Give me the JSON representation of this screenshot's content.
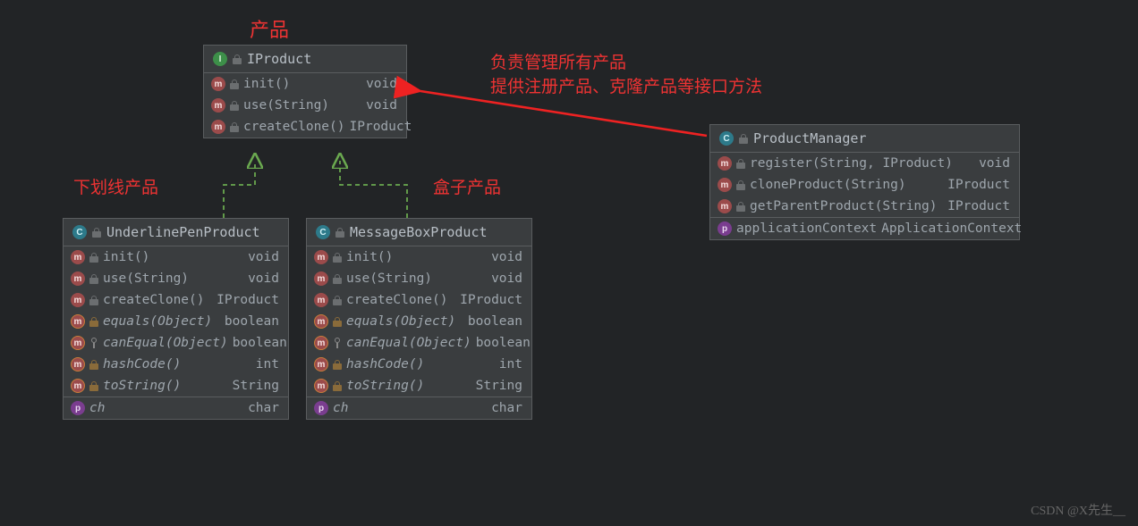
{
  "annotations": {
    "product": "产品",
    "underline": "下划线产品",
    "box": "盒子产品",
    "manager1": "负责管理所有产品",
    "manager2": "提供注册产品、克隆产品等接口方法"
  },
  "iproduct": {
    "title": "IProduct",
    "rows": [
      {
        "ic": "m",
        "sig": "init()",
        "ret": "void"
      },
      {
        "ic": "m",
        "sig": "use(String)",
        "ret": "void"
      },
      {
        "ic": "m",
        "sig": "createClone()",
        "ret": "IProduct"
      }
    ]
  },
  "underline": {
    "title": "UnderlinePenProduct",
    "rows": [
      {
        "ic": "m",
        "lock": true,
        "sig": "init()",
        "ret": "void",
        "ital": false
      },
      {
        "ic": "m",
        "lock": true,
        "sig": "use(String)",
        "ret": "void",
        "ital": false
      },
      {
        "ic": "m",
        "lock": true,
        "sig": "createClone()",
        "ret": "IProduct",
        "ital": false
      },
      {
        "ic": "mg",
        "ulock": true,
        "sig": "equals(Object)",
        "ret": "boolean",
        "ital": true
      },
      {
        "ic": "mg",
        "key": true,
        "sig": "canEqual(Object)",
        "ret": "boolean",
        "ital": true
      },
      {
        "ic": "mg",
        "ulock": true,
        "sig": "hashCode()",
        "ret": "int",
        "ital": true
      },
      {
        "ic": "mg",
        "ulock": true,
        "sig": "toString()",
        "ret": "String",
        "ital": true
      }
    ],
    "field": {
      "ic": "p",
      "sig": "ch",
      "ret": "char",
      "ital": true
    }
  },
  "messagebox": {
    "title": "MessageBoxProduct",
    "rows": [
      {
        "ic": "m",
        "lock": true,
        "sig": "init()",
        "ret": "void",
        "ital": false
      },
      {
        "ic": "m",
        "lock": true,
        "sig": "use(String)",
        "ret": "void",
        "ital": false
      },
      {
        "ic": "m",
        "lock": true,
        "sig": "createClone()",
        "ret": "IProduct",
        "ital": false
      },
      {
        "ic": "mg",
        "ulock": true,
        "sig": "equals(Object)",
        "ret": "boolean",
        "ital": true
      },
      {
        "ic": "mg",
        "key": true,
        "sig": "canEqual(Object)",
        "ret": "boolean",
        "ital": true
      },
      {
        "ic": "mg",
        "ulock": true,
        "sig": "hashCode()",
        "ret": "int",
        "ital": true
      },
      {
        "ic": "mg",
        "ulock": true,
        "sig": "toString()",
        "ret": "String",
        "ital": true
      }
    ],
    "field": {
      "ic": "p",
      "sig": "ch",
      "ret": "char",
      "ital": true
    }
  },
  "manager": {
    "title": "ProductManager",
    "rows": [
      {
        "ic": "m",
        "lock": true,
        "sig": "register(String, IProduct)",
        "ret": "void"
      },
      {
        "ic": "m",
        "lock": true,
        "sig": "cloneProduct(String)",
        "ret": "IProduct"
      },
      {
        "ic": "m",
        "lock": true,
        "sig": "getParentProduct(String)",
        "ret": "IProduct"
      }
    ],
    "field": {
      "ic": "p",
      "sig": "applicationContext",
      "ret": "ApplicationContext"
    }
  },
  "watermark": "CSDN @X先生__"
}
